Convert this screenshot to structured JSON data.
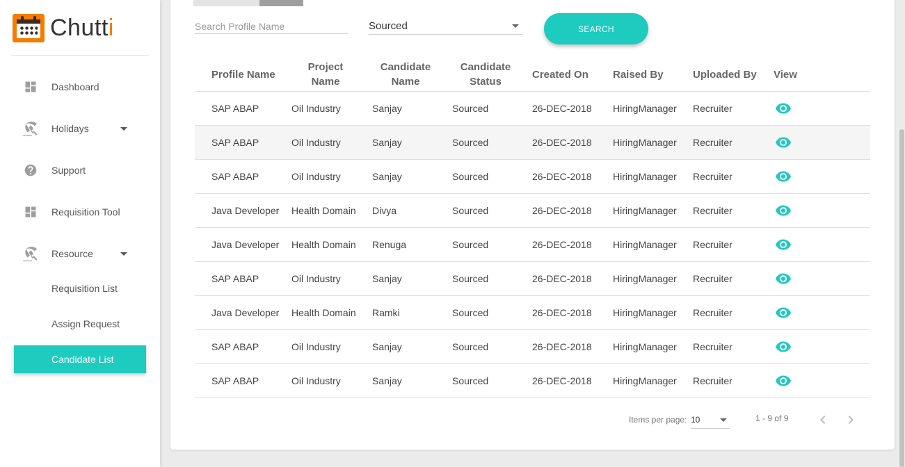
{
  "app": {
    "name_main": "Chutt",
    "name_accent": "i"
  },
  "sidebar": {
    "items": [
      {
        "label": "Dashboard",
        "icon": "dashboard-icon"
      },
      {
        "label": "Holidays",
        "icon": "beach-icon"
      },
      {
        "label": "Support",
        "icon": "help-icon"
      },
      {
        "label": "Requisition Tool",
        "icon": "dashboard-icon"
      },
      {
        "label": "Resource",
        "icon": "beach-icon"
      }
    ],
    "sub_items": [
      {
        "label": "Requisition List"
      },
      {
        "label": "Assign Request"
      }
    ],
    "active": {
      "label": "Candidate List"
    }
  },
  "filters": {
    "search_placeholder": "Search Profile Name",
    "status_selected": "Sourced",
    "search_button": "SEARCH"
  },
  "table": {
    "headers": [
      "Profile Name",
      "Project Name",
      "Candidate Name",
      "Candidate Status",
      "Created On",
      "Raised By",
      "Uploaded By",
      "View"
    ],
    "rows": [
      [
        "SAP ABAP",
        "Oil Industry",
        "Sanjay",
        "Sourced",
        "26-DEC-2018",
        "HiringManager",
        "Recruiter"
      ],
      [
        "SAP ABAP",
        "Oil Industry",
        "Sanjay",
        "Sourced",
        "26-DEC-2018",
        "HiringManager",
        "Recruiter"
      ],
      [
        "SAP ABAP",
        "Oil Industry",
        "Sanjay",
        "Sourced",
        "26-DEC-2018",
        "HiringManager",
        "Recruiter"
      ],
      [
        "Java Developer",
        "Health Domain",
        "Divya",
        "Sourced",
        "26-DEC-2018",
        "HiringManager",
        "Recruiter"
      ],
      [
        "Java Developer",
        "Health Domain",
        "Renuga",
        "Sourced",
        "26-DEC-2018",
        "HiringManager",
        "Recruiter"
      ],
      [
        "SAP ABAP",
        "Oil Industry",
        "Sanjay",
        "Sourced",
        "26-DEC-2018",
        "HiringManager",
        "Recruiter"
      ],
      [
        "Java Developer",
        "Health Domain",
        "Ramki",
        "Sourced",
        "26-DEC-2018",
        "HiringManager",
        "Recruiter"
      ],
      [
        "SAP ABAP",
        "Oil Industry",
        "Sanjay",
        "Sourced",
        "26-DEC-2018",
        "HiringManager",
        "Recruiter"
      ],
      [
        "SAP ABAP",
        "Oil Industry",
        "Sanjay",
        "Sourced",
        "26-DEC-2018",
        "HiringManager",
        "Recruiter"
      ]
    ]
  },
  "paginator": {
    "label": "Items per page:",
    "page_size": "10",
    "range": "1 - 9 of 9"
  },
  "colors": {
    "accent": "#1ecbbf",
    "brand": "#f57c00"
  }
}
